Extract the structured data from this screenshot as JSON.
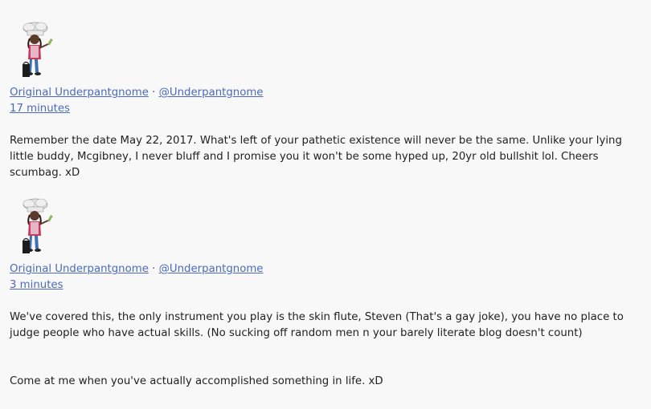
{
  "colors": {
    "background": "#f8f8f8",
    "link": "#4a6bbd",
    "text": "#222222"
  },
  "posts": [
    {
      "avatar_icon": "chef-gnome-avatar-icon",
      "author_name": "Original Underpantgnome",
      "separator": "·",
      "author_handle": "@Underpantgnome",
      "timestamp": "17 minutes",
      "paragraphs": [
        "Remember the date May 22, 2017. What's left of your pathetic existence will never be the same. Unlike your lying little buddy, Mcgibney, I never bluff and I promise you it won't be some hyped up, 20yr old bullshit lol. Cheers scumbag. xD"
      ]
    },
    {
      "avatar_icon": "chef-gnome-avatar-icon",
      "author_name": "Original Underpantgnome",
      "separator": "·",
      "author_handle": "@Underpantgnome",
      "timestamp": "3 minutes",
      "paragraphs": [
        "We've covered this, the only instrument you play is the skin flute, Steven (That's a gay joke), you have no place to judge people who have actual skills. (No sucking off random men n your barely literate blog doesn't count)",
        "Come at me when you've actually accomplished something in life. xD"
      ]
    }
  ]
}
